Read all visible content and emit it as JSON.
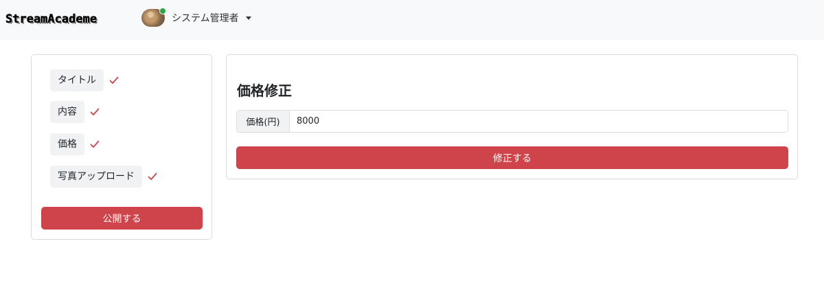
{
  "navbar": {
    "brand": "StreamAcademe",
    "user": {
      "name": "システム管理者",
      "avatar_icon": "dog-avatar",
      "status_color": "#28a745"
    }
  },
  "sidebar": {
    "steps": [
      {
        "label": "タイトル",
        "completed": true
      },
      {
        "label": "内容",
        "completed": true
      },
      {
        "label": "価格",
        "completed": true
      },
      {
        "label": "写真アップロード",
        "completed": true
      }
    ],
    "check_icon": "checkmark-icon",
    "check_color": "#cf444b",
    "publish_label": "公開する"
  },
  "main": {
    "title": "価格修正",
    "price_field": {
      "label": "価格(円)",
      "value": "8000"
    },
    "submit_label": "修正する"
  },
  "colors": {
    "accent": "#cf444b",
    "navbar_bg": "#f8f9fa"
  }
}
